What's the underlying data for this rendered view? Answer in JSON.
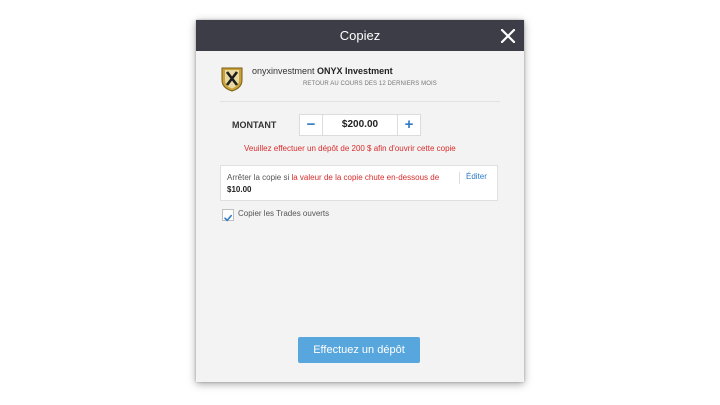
{
  "modal": {
    "title": "Copiez",
    "close_icon": "close-icon"
  },
  "trader": {
    "avatar_icon": "onyx-logo-icon",
    "username": "onyxinvestment",
    "display_name": "ONYX Investment",
    "subtitle": "RETOUR AU COURS DES 12 DERNIERS MOIS"
  },
  "amount": {
    "label": "MONTANT",
    "value": "$200.00",
    "minus_label": "−",
    "plus_label": "+"
  },
  "warning": "Veuillez effectuer un dépôt de 200 $ afin d'ouvrir cette copie",
  "stop_loss": {
    "prefix": "Arrêter la copie si",
    "highlight": "la valeur de la copie chute en-dessous de",
    "value": "$10.00",
    "edit_label": "Éditer"
  },
  "copy_open_trades": {
    "label": "Copier les Trades ouverts",
    "checked": true
  },
  "cta": {
    "label": "Effectuez un dépôt"
  },
  "colors": {
    "header_bg": "#3d3d47",
    "accent": "#2f7bc6",
    "warning": "#d92b2b",
    "cta_bg": "#57a6dd"
  }
}
